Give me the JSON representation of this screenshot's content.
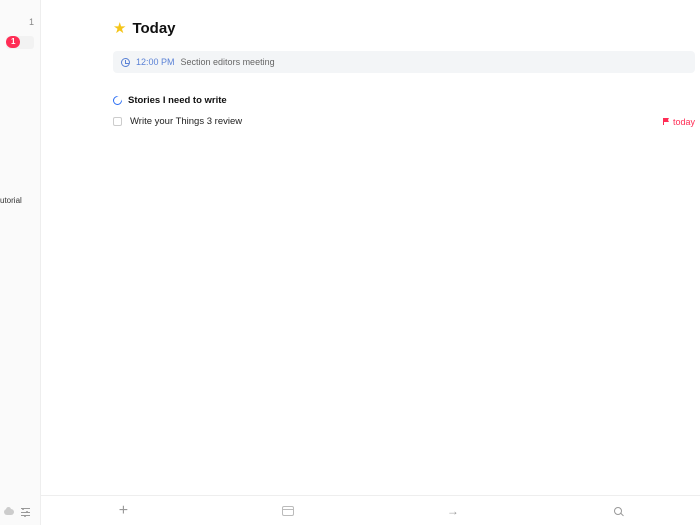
{
  "sidebar": {
    "count_top": "1",
    "badge": "1",
    "label_partial": "utorial"
  },
  "page": {
    "title": "Today"
  },
  "event": {
    "time": "12:00 PM",
    "name": "Section editors meeting"
  },
  "section": {
    "title": "Stories I need to write"
  },
  "tasks": [
    {
      "title": "Write your Things 3 review",
      "deadline": "today"
    }
  ]
}
